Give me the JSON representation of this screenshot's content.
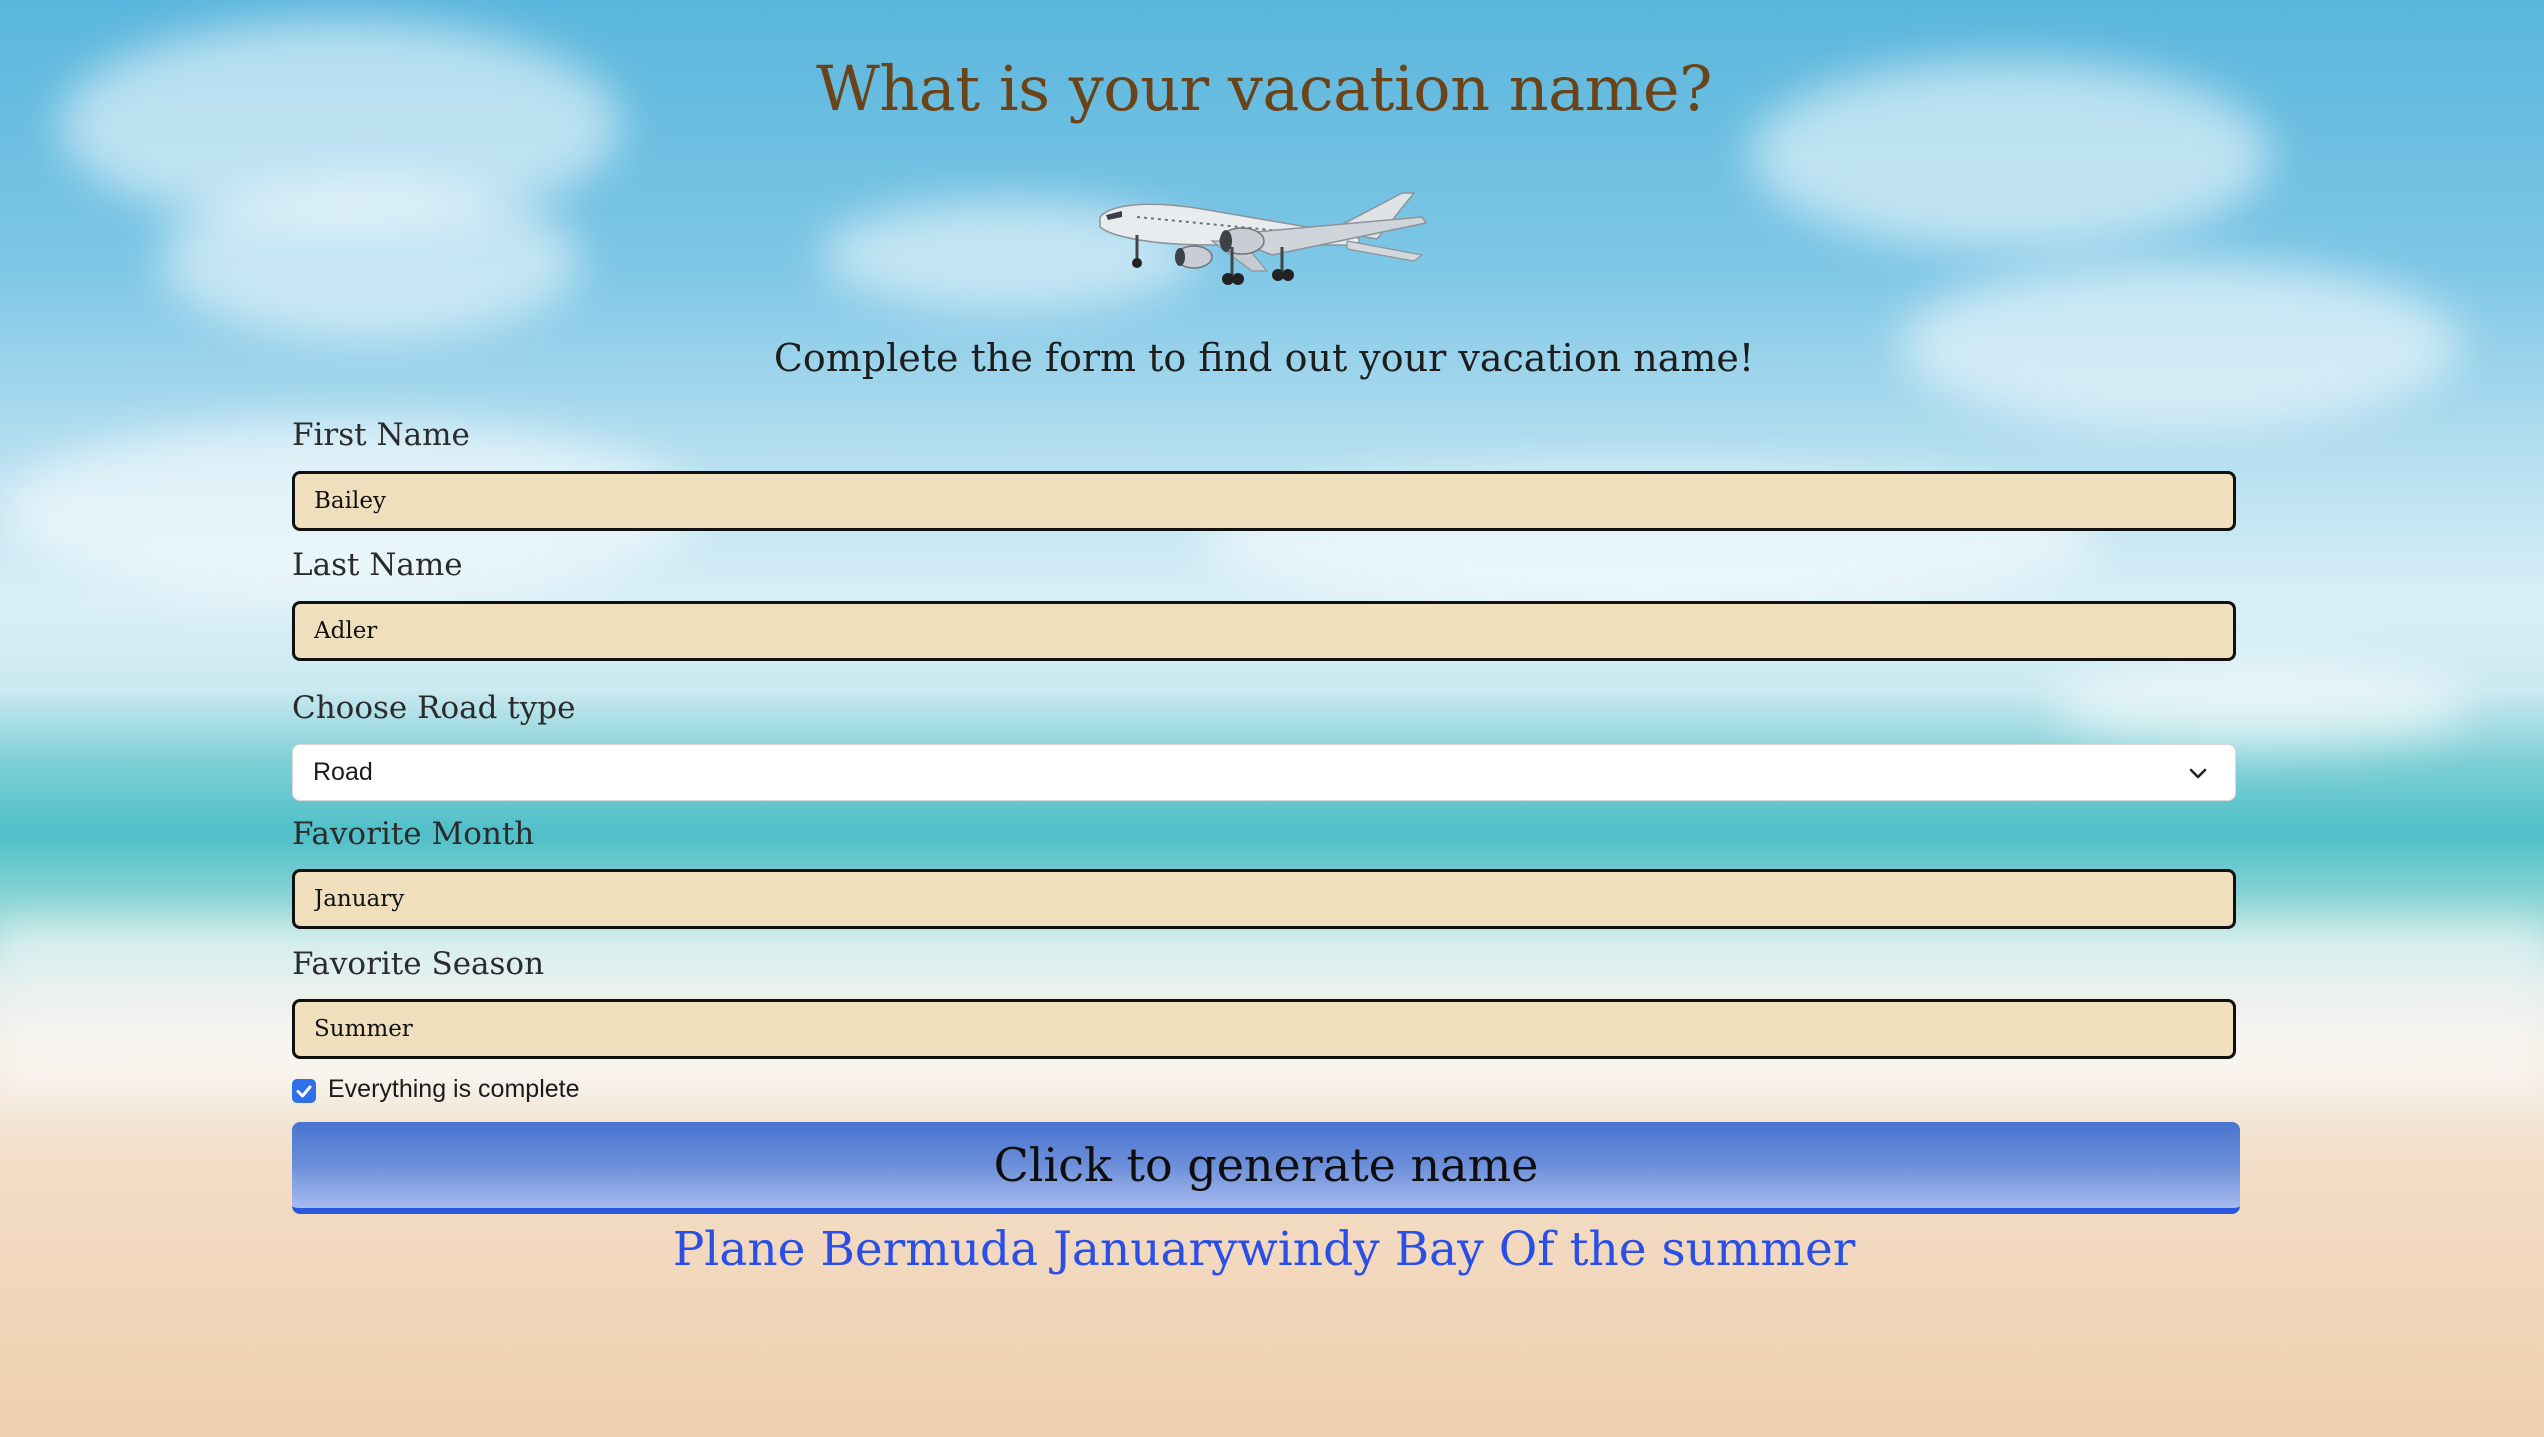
{
  "page": {
    "title": "What is your vacation name?",
    "subtitle": "Complete the form to find out your vacation name!"
  },
  "form": {
    "first_name": {
      "label": "First Name",
      "value": "Bailey"
    },
    "last_name": {
      "label": "Last Name",
      "value": "Adler"
    },
    "road_type": {
      "label": "Choose Road type",
      "selected": "Road"
    },
    "favorite_month": {
      "label": "Favorite Month",
      "value": "January"
    },
    "favorite_season": {
      "label": "Favorite Season",
      "value": "Summer"
    },
    "complete_checkbox": {
      "label": "Everything is complete",
      "checked": true
    },
    "generate_button": {
      "label": "Click to generate name"
    }
  },
  "result": {
    "text": "Plane Bermuda Januarywindy Bay Of the summer"
  },
  "colors": {
    "title": "#6a4418",
    "input_background": "#efdfbd",
    "button_gradient_top": "#4873cf",
    "button_gradient_bottom": "#a7bbee",
    "result_text": "#2a4ee8",
    "checkbox_accent": "#2f6fe8"
  },
  "icons": {
    "plane": "airplane-icon",
    "dropdown": "chevron-down-icon",
    "checkbox": "checkmark-icon"
  }
}
